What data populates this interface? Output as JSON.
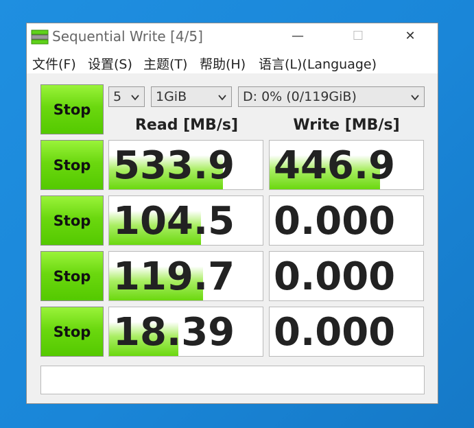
{
  "window": {
    "title": "Sequential Write [4/5]",
    "controls": {
      "minimize": "—",
      "maximize": "☐",
      "close": "✕"
    }
  },
  "menu": [
    "文件(F)",
    "设置(S)",
    "主题(T)",
    "帮助(H)",
    "语言(L)(Language)"
  ],
  "settings": {
    "count": "5",
    "size": "1GiB",
    "drive": "D: 0% (0/119GiB)"
  },
  "header": {
    "stop_label": "Stop",
    "read": "Read [MB/s]",
    "write": "Write [MB/s]"
  },
  "rows": [
    {
      "stop": "Stop",
      "read": "533.9",
      "write": "446.9",
      "read_fill": 0.74,
      "write_fill": 0.72
    },
    {
      "stop": "Stop",
      "read": "104.5",
      "write": "0.000",
      "read_fill": 0.6,
      "write_fill": 0
    },
    {
      "stop": "Stop",
      "read": "119.7",
      "write": "0.000",
      "read_fill": 0.61,
      "write_fill": 0
    },
    {
      "stop": "Stop",
      "read": "18.39",
      "write": "0.000",
      "read_fill": 0.45,
      "write_fill": 0
    }
  ],
  "status": "",
  "colors": {
    "accent_green": "#6bd80f",
    "desktop_blue": "#1a86d8"
  }
}
